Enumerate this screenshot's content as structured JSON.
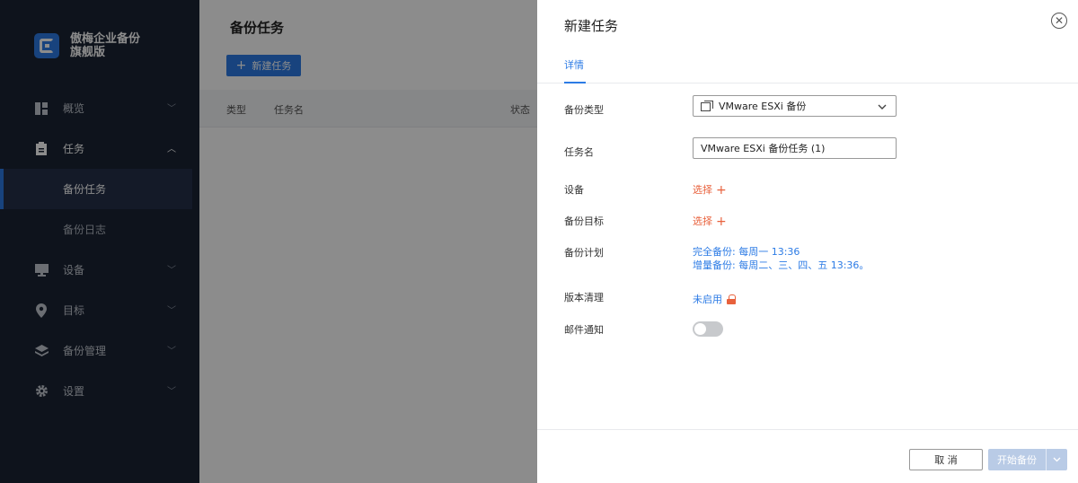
{
  "brand": {
    "name_line1": "傲梅企业备份",
    "name_line2": "旗舰版"
  },
  "sidebar": {
    "items": [
      {
        "label": "概览",
        "icon": "dashboard-icon"
      },
      {
        "label": "任务",
        "icon": "clipboard-icon"
      },
      {
        "label": "设备",
        "icon": "monitor-icon"
      },
      {
        "label": "目标",
        "icon": "location-pin-icon"
      },
      {
        "label": "备份管理",
        "icon": "layers-icon"
      },
      {
        "label": "设置",
        "icon": "gear-icon"
      }
    ],
    "sub_items": [
      {
        "label": "备份任务"
      },
      {
        "label": "备份日志"
      }
    ]
  },
  "main": {
    "title": "备份任务",
    "new_button": "新建任务",
    "columns": [
      "类型",
      "任务名",
      "状态"
    ]
  },
  "drawer": {
    "title": "新建任务",
    "tab": "详情",
    "labels": {
      "backup_type": "备份类型",
      "task_name": "任务名",
      "device": "设备",
      "target": "备份目标",
      "schedule": "备份计划",
      "version_cleanup": "版本清理",
      "email": "邮件通知"
    },
    "backup_type_value": "VMware ESXi 备份",
    "task_name_value": "VMware ESXi 备份任务 (1)",
    "select_link": "选择",
    "schedule_full": "完全备份: 每周一 13:36",
    "schedule_incremental": "增量备份: 每周二、三、四、五 13:36。",
    "cleanup_status": "未启用",
    "email_enabled": false,
    "cancel_button": "取 消",
    "start_button": "开始备份"
  },
  "colors": {
    "accent": "#2c7be5",
    "link_orange": "#e8613c",
    "sidebar_bg": "#1a2333"
  }
}
